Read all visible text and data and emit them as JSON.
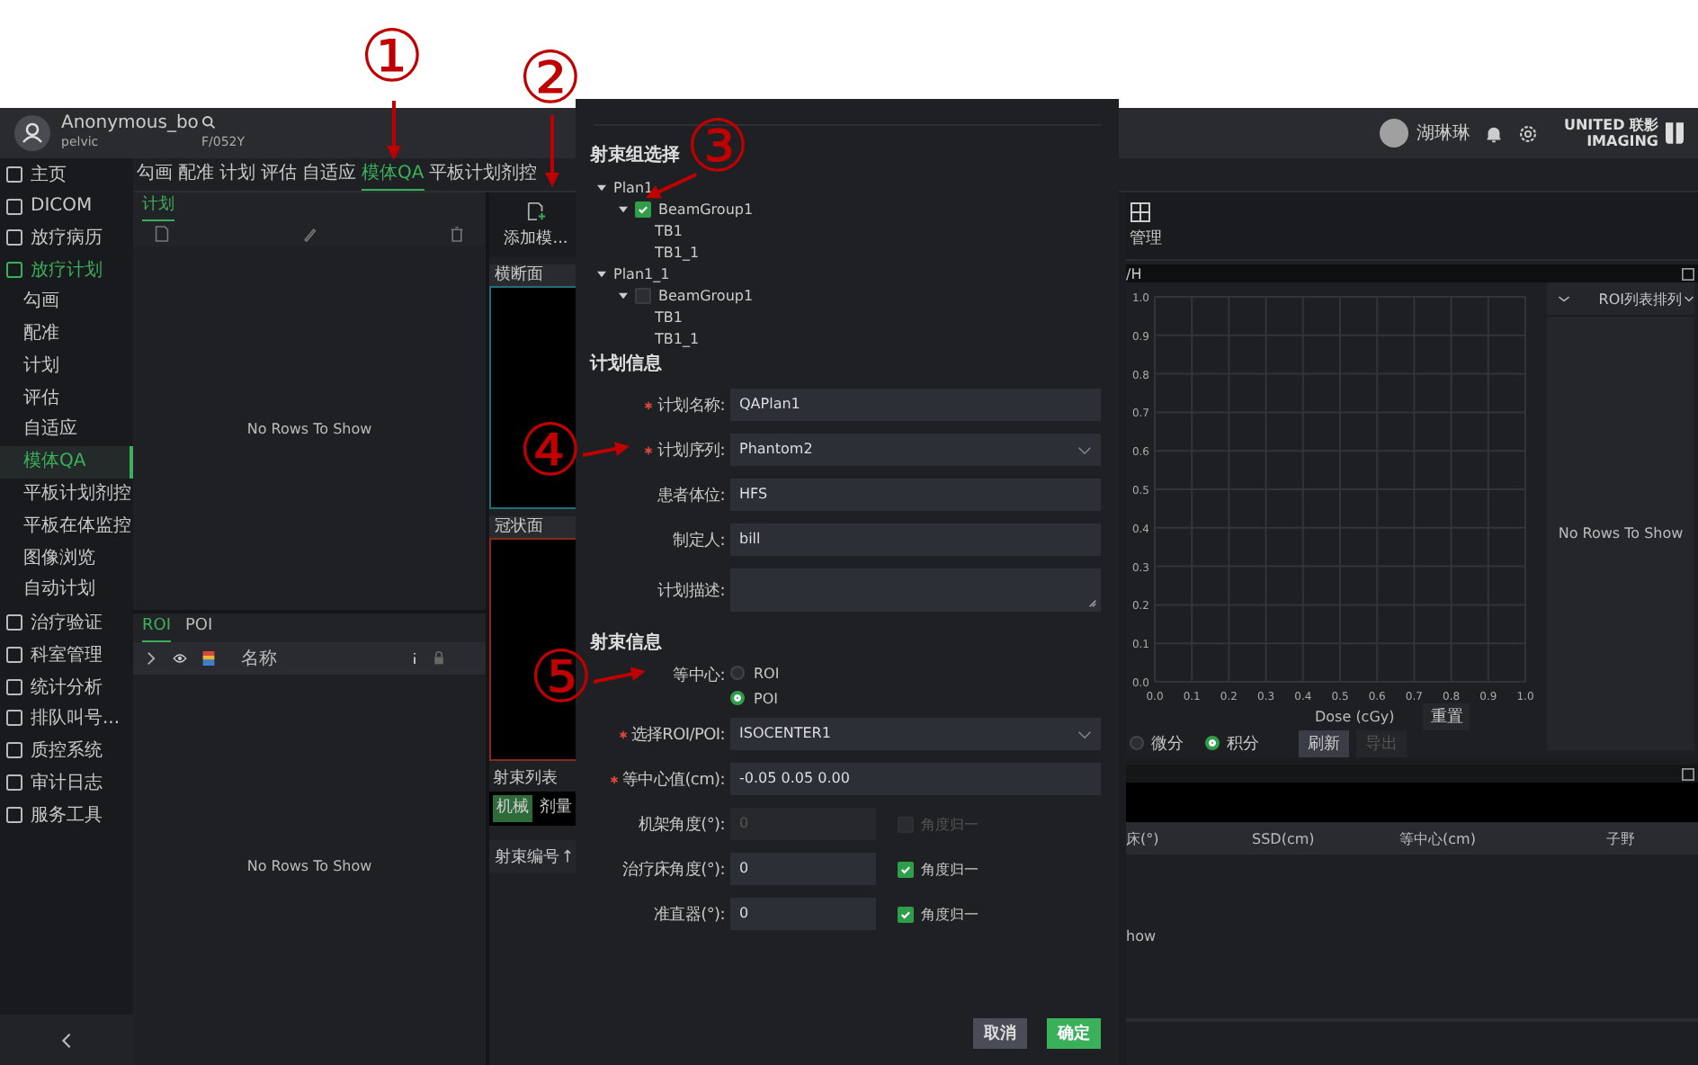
{
  "header": {
    "patient_name": "Anonymous_bo",
    "patient_site": "pelvic",
    "patient_id": "F/052Y",
    "user_name": "湖琳琳",
    "logo_line_1": "UNITED 联影",
    "logo_line_2": "IMAGING"
  },
  "sidebar": {
    "items": [
      {
        "label": "主页",
        "active": false
      },
      {
        "label": "DICOM",
        "active": false
      },
      {
        "label": "放疗病历",
        "active": false
      },
      {
        "label": "放疗计划",
        "active": true,
        "children": [
          {
            "label": "勾画",
            "selected": false
          },
          {
            "label": "配准",
            "selected": false
          },
          {
            "label": "计划",
            "selected": false
          },
          {
            "label": "评估",
            "selected": false
          },
          {
            "label": "自适应",
            "selected": false
          },
          {
            "label": "模体QA",
            "selected": true
          },
          {
            "label": "平板计划剂控",
            "selected": false
          },
          {
            "label": "平板在体监控",
            "selected": false
          },
          {
            "label": "图像浏览",
            "selected": false
          },
          {
            "label": "自动计划",
            "selected": false
          }
        ]
      },
      {
        "label": "治疗验证",
        "active": false
      },
      {
        "label": "科室管理",
        "active": false
      },
      {
        "label": "统计分析",
        "active": false
      },
      {
        "label": "排队叫号...",
        "active": false
      },
      {
        "label": "质控系统",
        "active": false
      },
      {
        "label": "审计日志",
        "active": false
      },
      {
        "label": "服务工具",
        "active": false
      }
    ]
  },
  "module_tabs": [
    {
      "label": "勾画",
      "selected": false
    },
    {
      "label": "配准",
      "selected": false
    },
    {
      "label": "计划",
      "selected": false
    },
    {
      "label": "评估",
      "selected": false
    },
    {
      "label": "自适应",
      "selected": false
    },
    {
      "label": "模体QA",
      "selected": true
    },
    {
      "label": "平板计划剂控",
      "selected": false
    }
  ],
  "plan_panel": {
    "tab": "计划",
    "empty_text": "No Rows To Show"
  },
  "roi_panel": {
    "tabs": [
      {
        "label": "ROI",
        "selected": true
      },
      {
        "label": "POI",
        "selected": false
      }
    ],
    "column": "名称",
    "empty_text": "No Rows To Show"
  },
  "view_panel": {
    "add_button": "添加模...",
    "views": [
      {
        "label": "横断面",
        "color": "#1e6f7a"
      },
      {
        "label": "冠状面",
        "color": "#8a2a1e"
      }
    ],
    "beam_tab": "射束列表",
    "modes": [
      {
        "label": "机械",
        "selected": true
      },
      {
        "label": "剂量",
        "selected": false
      }
    ],
    "column": "射束编号"
  },
  "right_panel": {
    "toolbar_button": "管理",
    "dvh": {
      "title": "/H",
      "chart_data": {
        "type": "line",
        "grid": true,
        "xlabel": "Dose (cGy)",
        "xlim": [
          0,
          1
        ],
        "ylim": [
          0,
          1
        ],
        "xticks": [
          {
            "value": 0,
            "label": "0.0"
          },
          {
            "value": 0.1,
            "label": "0.1"
          },
          {
            "value": 0.2,
            "label": "0.2"
          },
          {
            "value": 0.3,
            "label": "0.3"
          },
          {
            "value": 0.4,
            "label": "0.4"
          },
          {
            "value": 0.5,
            "label": "0.5"
          },
          {
            "value": 0.6,
            "label": "0.6"
          },
          {
            "value": 0.7,
            "label": "0.7"
          },
          {
            "value": 0.8,
            "label": "0.8"
          },
          {
            "value": 0.9,
            "label": "0.9"
          },
          {
            "value": 1,
            "label": "1.0"
          }
        ],
        "yticks": [
          {
            "value": 0,
            "label": "0.0"
          },
          {
            "value": 0.1,
            "label": "0.1"
          },
          {
            "value": 0.2,
            "label": "0.2"
          },
          {
            "value": 0.3,
            "label": "0.3"
          },
          {
            "value": 0.4,
            "label": "0.4"
          },
          {
            "value": 0.5,
            "label": "0.5"
          },
          {
            "value": 0.6,
            "label": "0.6"
          },
          {
            "value": 0.7,
            "label": "0.7"
          },
          {
            "value": 0.8,
            "label": "0.8"
          },
          {
            "value": 0.9,
            "label": "0.9"
          },
          {
            "value": 1,
            "label": "1.0"
          }
        ]
      },
      "reset_button": "重置",
      "modes": [
        {
          "label": "微分",
          "selected": false
        },
        {
          "label": "积分",
          "selected": true
        }
      ],
      "refresh_button": "刷新",
      "export_button": {
        "label": "导出",
        "disabled": true
      }
    },
    "roi_list": {
      "sort_label": "ROI列表排列",
      "empty_text": "No Rows To Show"
    },
    "beam_table": {
      "columns": [
        "床(°)",
        "SSD(cm)",
        "等中心(cm)",
        "子野"
      ],
      "empty_text": "how"
    }
  },
  "dialog": {
    "beam_group_title": "射束组选择",
    "tree": [
      {
        "label": "Plan1",
        "expanded": true,
        "children": [
          {
            "label": "BeamGroup1",
            "expanded": true,
            "checked": true,
            "children": [
              {
                "label": "TB1"
              },
              {
                "label": "TB1_1"
              }
            ]
          }
        ]
      },
      {
        "label": "Plan1_1",
        "expanded": true,
        "children": [
          {
            "label": "BeamGroup1",
            "expanded": true,
            "checked": false,
            "children": [
              {
                "label": "TB1"
              },
              {
                "label": "TB1_1"
              }
            ]
          }
        ]
      }
    ],
    "plan_title": "计划信息",
    "plan_fields": [
      {
        "kind": "input",
        "label": "计划名称:",
        "required": true,
        "value": "QAPlan1"
      },
      {
        "kind": "select",
        "label": "计划序列:",
        "required": true,
        "value": "Phantom2"
      },
      {
        "kind": "input",
        "label": "患者体位:",
        "required": false,
        "value": "HFS"
      },
      {
        "kind": "input",
        "label": "制定人:",
        "required": false,
        "value": "bill"
      },
      {
        "kind": "textarea",
        "label": "计划描述:",
        "required": false
      }
    ],
    "beam_title": "射束信息",
    "isocenter": {
      "label": "等中心:",
      "options": [
        {
          "label": "ROI",
          "selected": false
        },
        {
          "label": "POI",
          "selected": true
        }
      ]
    },
    "beam_fields": [
      {
        "kind": "select",
        "label": "选择ROI/POI:",
        "required": true,
        "value": "ISOCENTER1"
      },
      {
        "kind": "input",
        "label": "等中心值(cm):",
        "required": true,
        "value": "-0.05 0.05 0.00"
      },
      {
        "kind": "angle",
        "label": "机架角度(°):",
        "required": false,
        "value": "0",
        "disabled": true,
        "normalize": {
          "label": "角度归一",
          "checked": false
        }
      },
      {
        "kind": "angle",
        "label": "治疗床角度(°):",
        "required": false,
        "value": "0",
        "disabled": false,
        "normalize": {
          "label": "角度归一",
          "checked": true
        }
      },
      {
        "kind": "angle",
        "label": "准直器(°):",
        "required": false,
        "value": "0",
        "disabled": false,
        "normalize": {
          "label": "角度归一",
          "checked": true
        }
      }
    ],
    "cancel_button": "取消",
    "ok_button": "确定"
  },
  "annotations": [
    {
      "label": "①"
    },
    {
      "label": "②"
    },
    {
      "label": "③"
    },
    {
      "label": "④"
    },
    {
      "label": "⑤"
    }
  ]
}
